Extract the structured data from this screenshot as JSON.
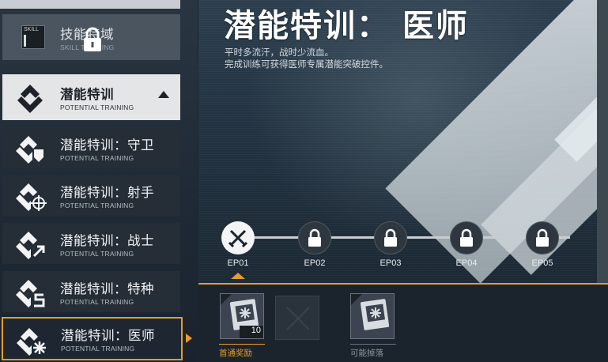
{
  "sidebar": {
    "skill_item": {
      "title": "技能特域",
      "subtitle": "SKILL TRAINING",
      "box_label": "SKILL"
    },
    "potential_item": {
      "title": "潜能特训",
      "subtitle": "POTENTIAL TRAINING"
    },
    "sub_items": [
      {
        "title": "潜能特训：守卫",
        "subtitle": "POTENTIAL TRAINING"
      },
      {
        "title": "潜能特训：射手",
        "subtitle": "POTENTIAL TRAINING"
      },
      {
        "title": "潜能特训：战士",
        "subtitle": "POTENTIAL TRAINING"
      },
      {
        "title": "潜能特训：特种",
        "subtitle": "POTENTIAL TRAINING"
      },
      {
        "title": "潜能特训：医师",
        "subtitle": "POTENTIAL TRAINING"
      }
    ]
  },
  "main": {
    "title": "潜能特训： 医师",
    "desc_line1": "平时多流汗，战时少流血。",
    "desc_line2": "完成训练可获得医师专属潜能突破控件。",
    "episodes": [
      {
        "label": "EP01",
        "state": "open"
      },
      {
        "label": "EP02",
        "state": "locked"
      },
      {
        "label": "EP03",
        "state": "locked"
      },
      {
        "label": "EP04",
        "state": "locked"
      },
      {
        "label": "EP05",
        "state": "locked"
      }
    ]
  },
  "rewards": {
    "first_clear_label": "首通奖励",
    "first_clear_count": "10",
    "possible_drop_label": "可能掉落"
  },
  "colors": {
    "accent": "#e89b2a",
    "panel": "#1b242d",
    "selected_bg": "#e3e5e6"
  }
}
